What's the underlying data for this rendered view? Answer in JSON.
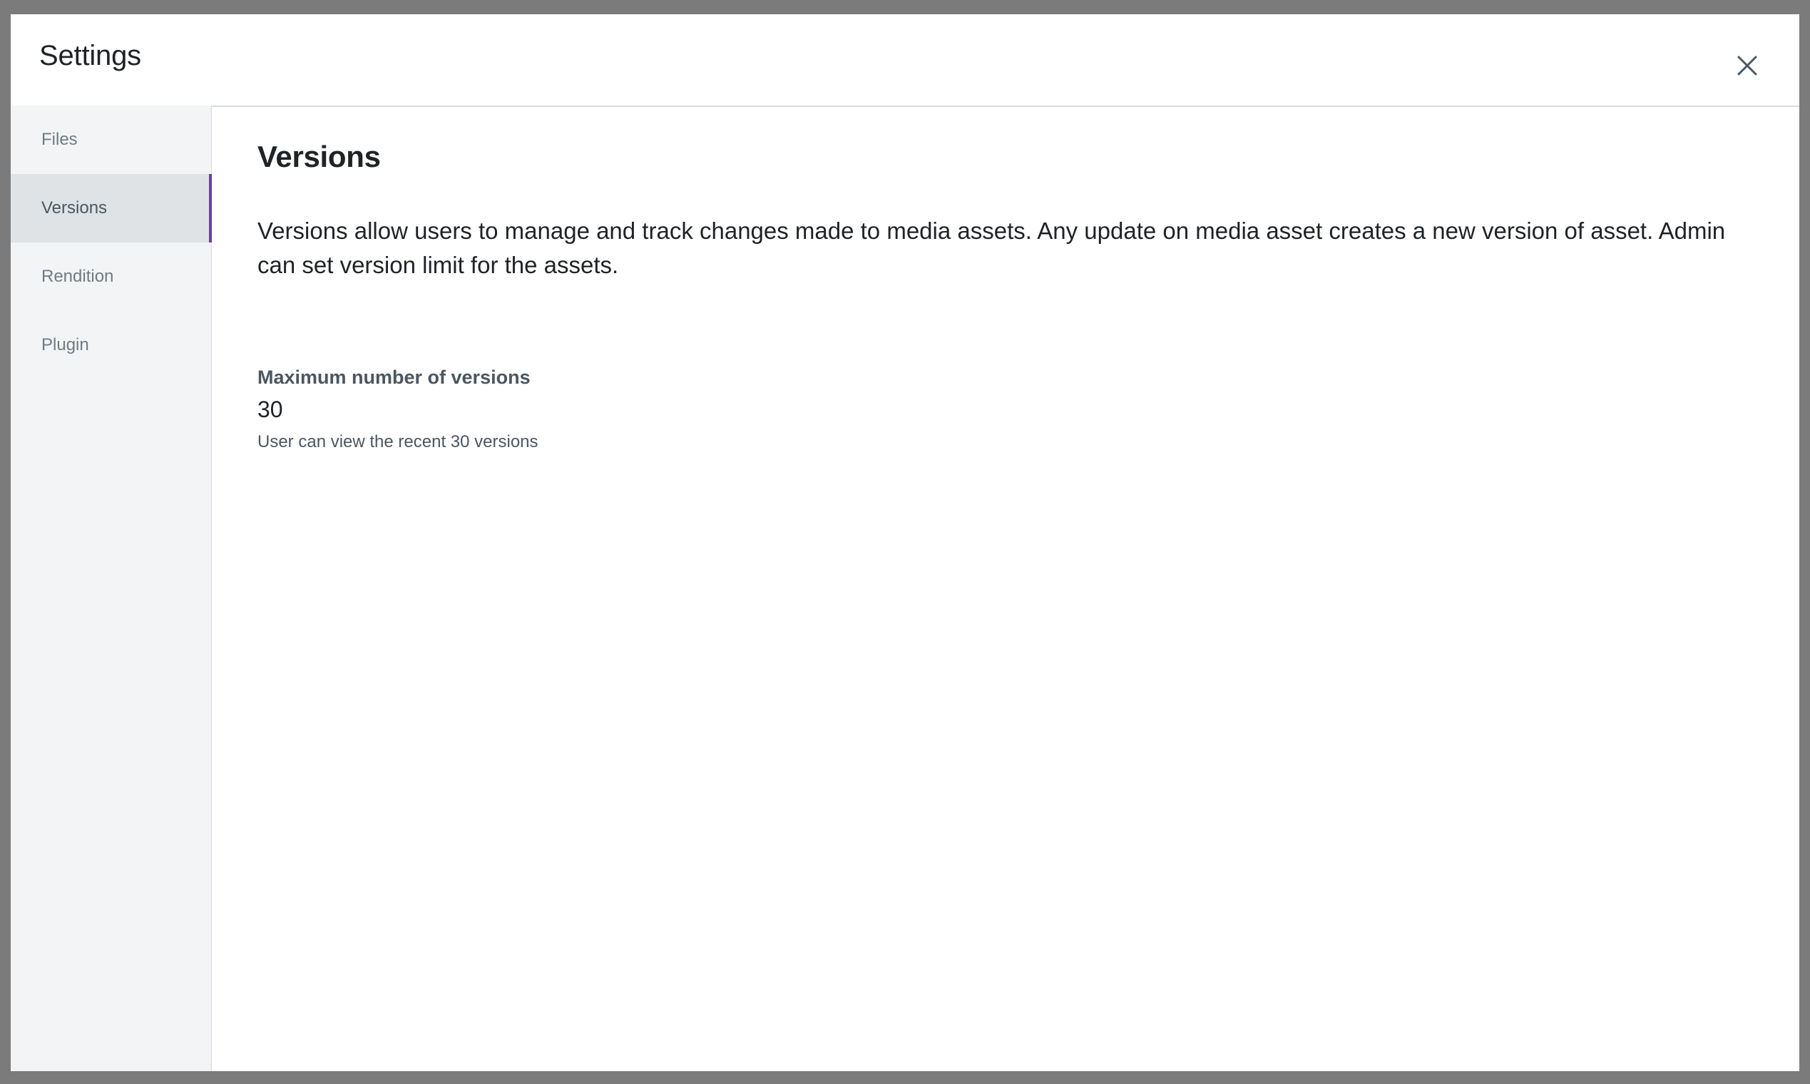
{
  "dialog": {
    "title": "Settings",
    "close_icon": "close-icon"
  },
  "sidebar": {
    "items": [
      {
        "label": "Files",
        "active": false
      },
      {
        "label": "Versions",
        "active": true
      },
      {
        "label": "Rendition",
        "active": false
      },
      {
        "label": "Plugin",
        "active": false
      }
    ]
  },
  "content": {
    "title": "Versions",
    "description": "Versions allow users to manage and track changes made to media assets. Any update on media asset creates a new version of asset. Admin can set version limit for the assets.",
    "max_versions": {
      "label": "Maximum number of versions",
      "value": "30",
      "help": "User can view the recent 30 versions"
    }
  },
  "colors": {
    "accent": "#6a3ea3",
    "sidebar_bg": "#f2f4f5",
    "sidebar_active_bg": "#dfe3e6",
    "backdrop": "#7b7b7b"
  }
}
